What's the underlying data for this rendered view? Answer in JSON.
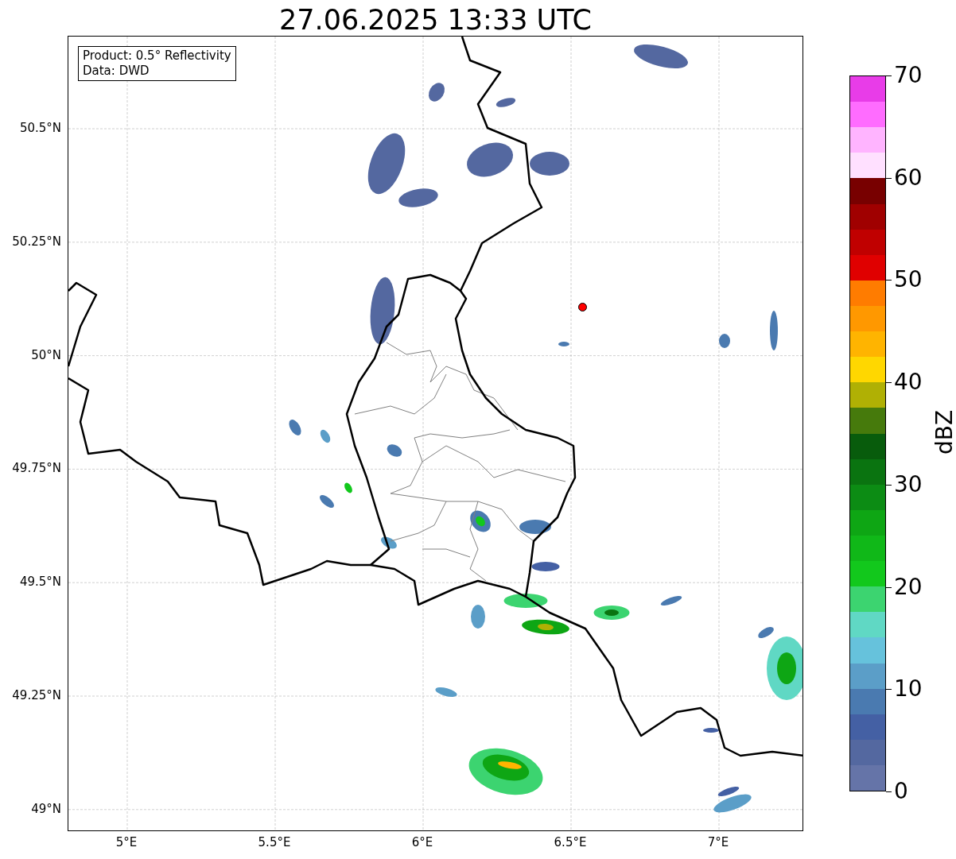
{
  "title": "27.06.2025 13:33 UTC",
  "info_box": [
    "Product: 0.5° Reflectivity",
    "Data: DWD"
  ],
  "map": {
    "x_ticks": [
      "5°E",
      "5.5°E",
      "6°E",
      "6.5°E",
      "7°E"
    ],
    "y_ticks": [
      "50.5°N",
      "50.25°N",
      "50°N",
      "49.75°N",
      "49.5°N",
      "49.25°N",
      "49°N"
    ]
  },
  "colorbar": {
    "label": "dBZ",
    "ticks": [
      "70",
      "60",
      "50",
      "40",
      "30",
      "20",
      "10",
      "0"
    ],
    "segments": [
      {
        "color": "#e83ce8"
      },
      {
        "color": "#ff6cff"
      },
      {
        "color": "#ffb4ff"
      },
      {
        "color": "#ffe0ff"
      },
      {
        "color": "#780000"
      },
      {
        "color": "#a00000"
      },
      {
        "color": "#c00000"
      },
      {
        "color": "#e00000"
      },
      {
        "color": "#ff7c00"
      },
      {
        "color": "#ff9800"
      },
      {
        "color": "#ffb400"
      },
      {
        "color": "#ffd700"
      },
      {
        "color": "#b0b004"
      },
      {
        "color": "#467a0c"
      },
      {
        "color": "#085c0c"
      },
      {
        "color": "#0a7410"
      },
      {
        "color": "#0c8c14"
      },
      {
        "color": "#0ea614"
      },
      {
        "color": "#10b818"
      },
      {
        "color": "#12c81c"
      },
      {
        "color": "#3cd470"
      },
      {
        "color": "#60d8c4"
      },
      {
        "color": "#66c2dc"
      },
      {
        "color": "#5b9ec8"
      },
      {
        "color": "#4a7ab0"
      },
      {
        "color": "#4460a4"
      },
      {
        "color": "#5468a0"
      },
      {
        "color": "#6574a8"
      }
    ]
  }
}
